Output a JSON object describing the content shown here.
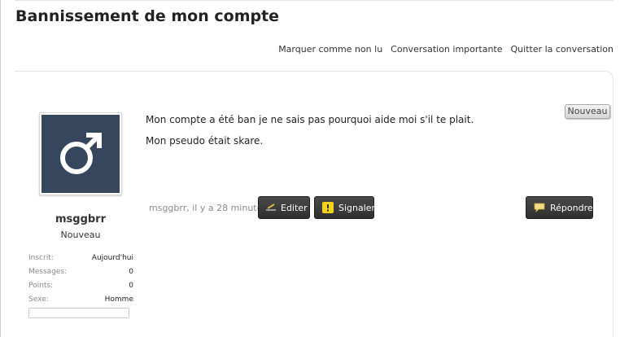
{
  "thread": {
    "title": "Bannissement de mon compte",
    "actions": [
      "Marquer comme non lu",
      "Conversation importante",
      "Quitter la conversation"
    ]
  },
  "post": {
    "author": {
      "username": "msggbrr",
      "title": "Nouveau",
      "avatar_icon": "male-symbol-icon",
      "stats": [
        {
          "label": "Inscrit:",
          "value": "Aujourd'hui"
        },
        {
          "label": "Messages:",
          "value": "0"
        },
        {
          "label": "Points:",
          "value": "0"
        },
        {
          "label": "Sexe:",
          "value": "Homme"
        }
      ]
    },
    "body": [
      "Mon compte a été ban je ne sais pas pourquoi aide moi s'il te plait.",
      "Mon pseudo était skare."
    ],
    "badge": "Nouveau",
    "meta": "msggbrr, il y a 28 minutes",
    "buttons": {
      "edit": "Editer",
      "report": "Signaler",
      "reply": "Répondre"
    }
  },
  "colors": {
    "avatar_bg": "#36475d",
    "button_bg": "#3a3a3a",
    "report_icon": "#f2d21b"
  }
}
